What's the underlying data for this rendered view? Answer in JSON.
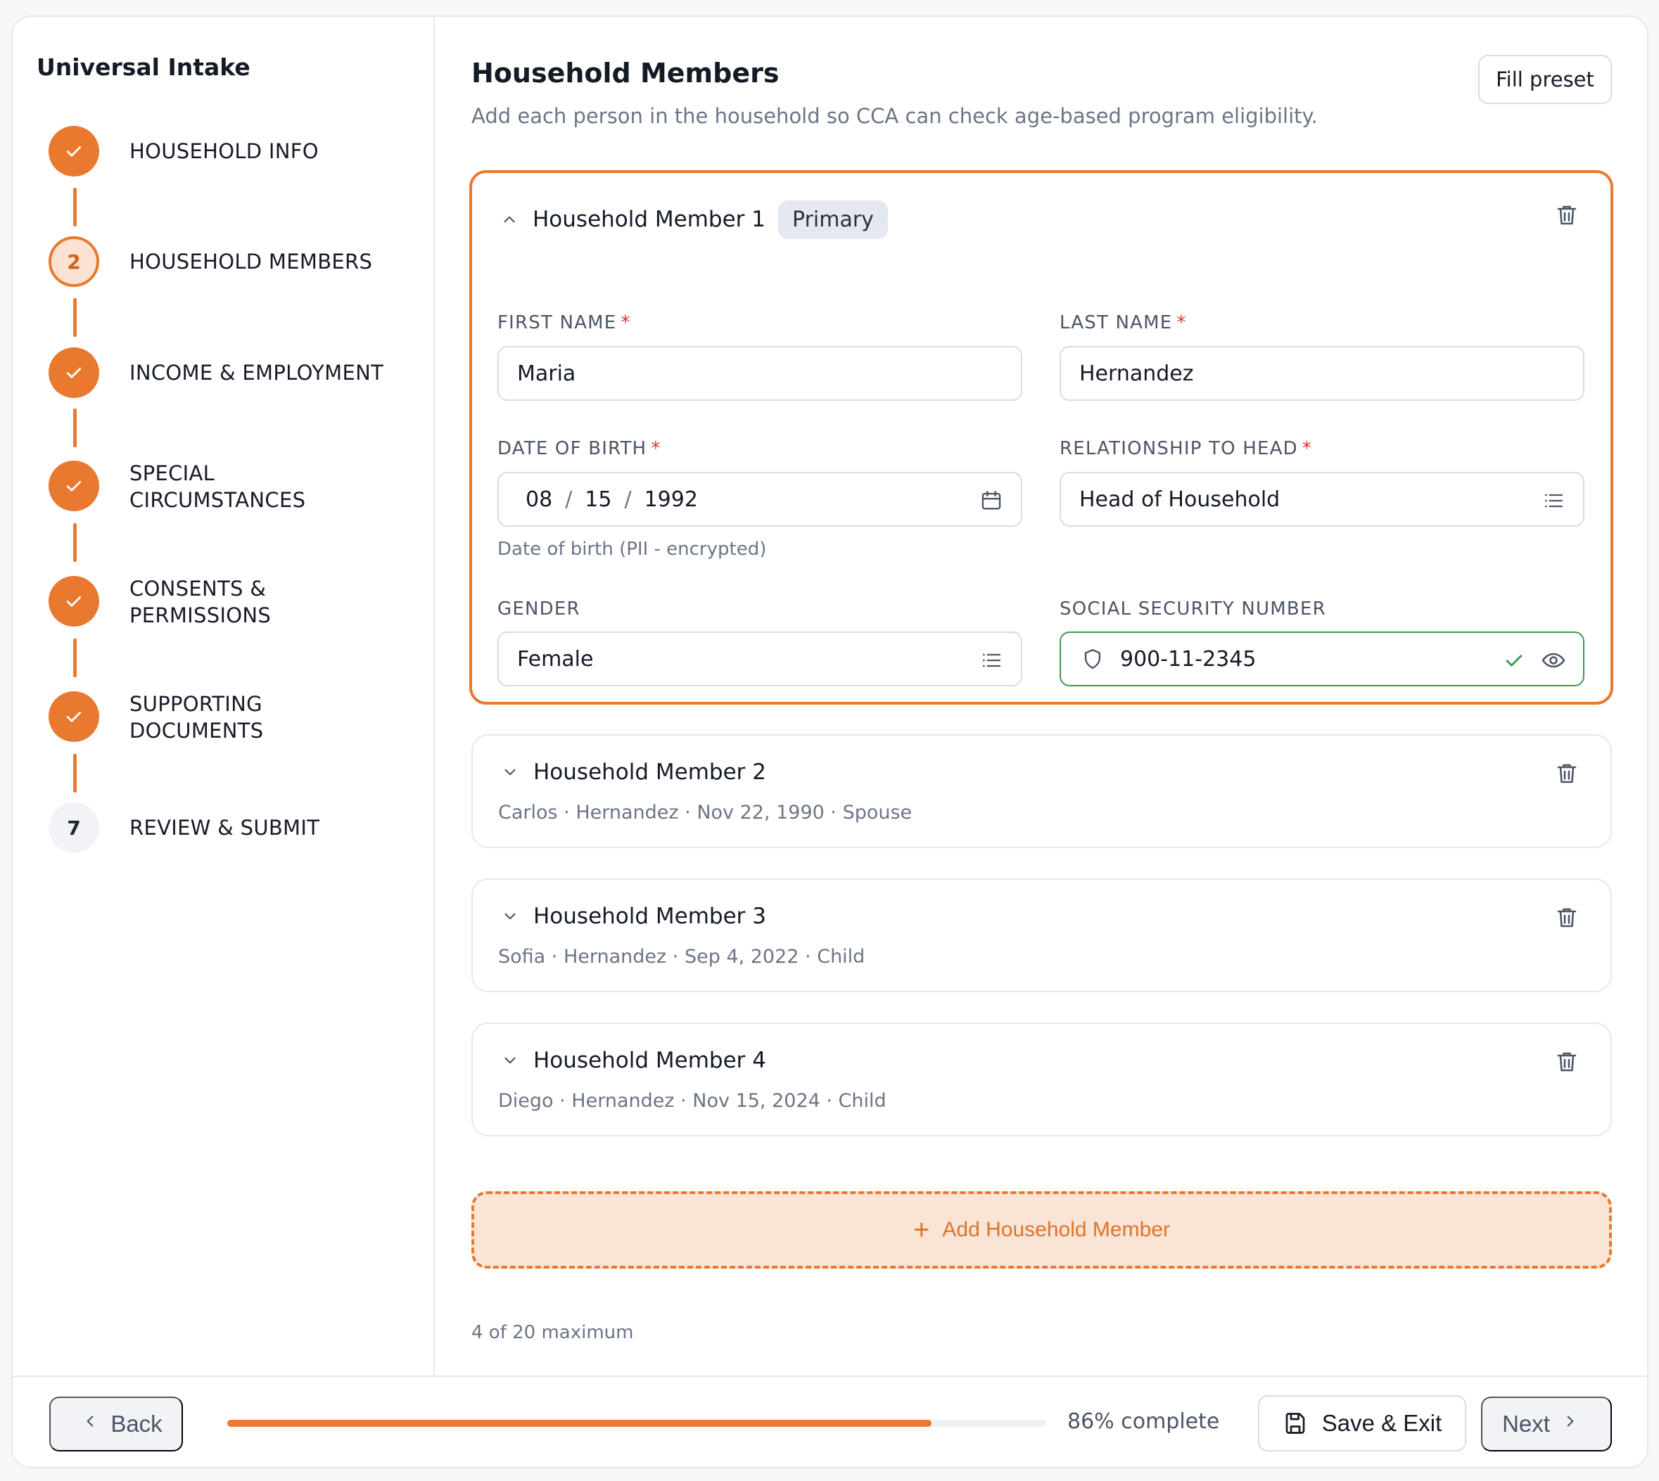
{
  "sidebar": {
    "title": "Universal Intake",
    "steps": [
      {
        "number": "1",
        "label": "HOUSEHOLD INFO",
        "status": "done"
      },
      {
        "number": "2",
        "label": "HOUSEHOLD MEMBERS",
        "status": "current"
      },
      {
        "number": "3",
        "label": "INCOME & EMPLOYMENT",
        "status": "done"
      },
      {
        "number": "4",
        "label": "SPECIAL CIRCUMSTANCES",
        "status": "done"
      },
      {
        "number": "5",
        "label": "CONSENTS & PERMISSIONS",
        "status": "done"
      },
      {
        "number": "6",
        "label": "SUPPORTING DOCUMENTS",
        "status": "done"
      },
      {
        "number": "7",
        "label": "REVIEW & SUBMIT",
        "status": "todo"
      }
    ]
  },
  "main": {
    "title": "Household Members",
    "subtitle": "Add each person in the household so CCA can check age-based program eligibility.",
    "fill_preset_label": "Fill preset",
    "members": [
      {
        "title": "Household Member 1",
        "badge": "Primary",
        "expanded": true,
        "fields": {
          "first_name": {
            "label": "FIRST NAME",
            "required": "*",
            "value": "Maria"
          },
          "last_name": {
            "label": "LAST NAME",
            "required": "*",
            "value": "Hernandez"
          },
          "dob": {
            "label": "DATE OF BIRTH",
            "required": "*",
            "month": "08",
            "sep": "/",
            "day": "15",
            "year": "1992",
            "help": "Date of birth (PII - encrypted)"
          },
          "relationship": {
            "label": "RELATIONSHIP TO HEAD",
            "required": "*",
            "value": "Head of Household"
          },
          "gender": {
            "label": "GENDER",
            "value": "Female"
          },
          "ssn": {
            "label": "SOCIAL SECURITY NUMBER",
            "value": "900-11-2345"
          }
        }
      },
      {
        "title": "Household Member 2",
        "summary": "Carlos · Hernandez · Nov 22, 1990 · Spouse",
        "expanded": false
      },
      {
        "title": "Household Member 3",
        "summary": "Sofia · Hernandez · Sep 4, 2022 · Child",
        "expanded": false
      },
      {
        "title": "Household Member 4",
        "summary": "Diego · Hernandez · Nov 15, 2024 · Child",
        "expanded": false
      }
    ],
    "add_member_label": "Add Household Member",
    "max_note": "4 of 20 maximum"
  },
  "footer": {
    "back_label": "Back",
    "progress_percent": 86,
    "progress_text": "86% complete",
    "save_label": "Save & Exit",
    "next_label": "Next"
  },
  "colors": {
    "accent": "#e8792f",
    "valid": "#3a9a4c",
    "required": "#d9342b"
  },
  "icons": [
    "check-icon",
    "chevron-up-icon",
    "chevron-down-icon",
    "trash-icon",
    "calendar-icon",
    "list-icon",
    "shield-icon",
    "eye-icon",
    "plus-icon",
    "chevron-left-icon",
    "chevron-right-icon",
    "save-icon"
  ]
}
